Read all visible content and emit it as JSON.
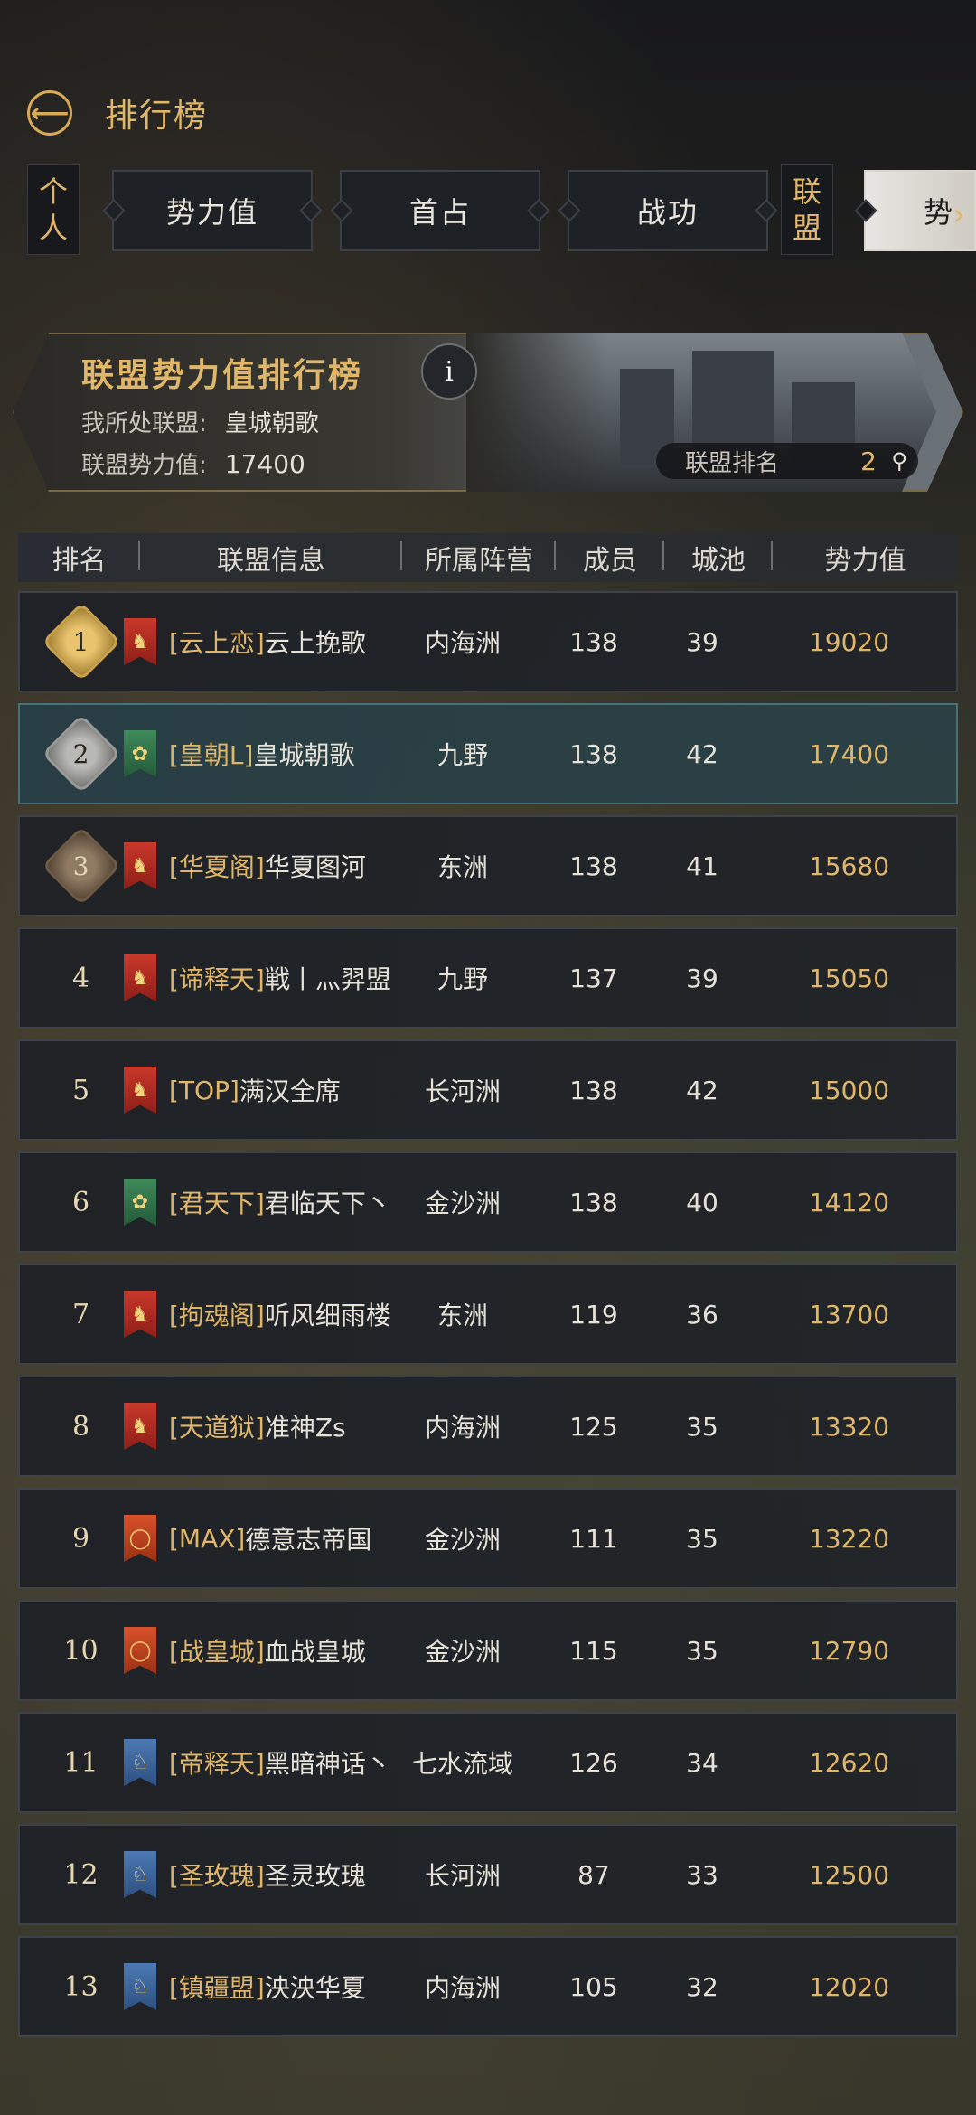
{
  "header": {
    "title": "排行榜"
  },
  "tabs": {
    "personal_label": [
      "个",
      "人"
    ],
    "items": [
      "势力值",
      "首占",
      "战功"
    ],
    "alliance_label": [
      "联",
      "盟"
    ],
    "active": "势"
  },
  "banner": {
    "title": "联盟势力值排行榜",
    "my_alliance_label": "我所处联盟:",
    "my_alliance_value": "皇城朝歌",
    "power_label": "联盟势力值:",
    "power_value": "17400",
    "rank_label": "联盟排名",
    "rank_value": "2"
  },
  "table": {
    "headers": [
      "排名",
      "联盟信息",
      "所属阵营",
      "成员",
      "城池",
      "势力值"
    ],
    "rows": [
      {
        "rank": "1",
        "tag": "[云上恋]",
        "name": "云上挽歌",
        "camp": "内海洲",
        "members": "138",
        "cities": "39",
        "power": "19020",
        "flag": "red"
      },
      {
        "rank": "2",
        "tag": "[皇朝L]",
        "name": "皇城朝歌",
        "camp": "九野",
        "members": "138",
        "cities": "42",
        "power": "17400",
        "flag": "green"
      },
      {
        "rank": "3",
        "tag": "[华夏阁]",
        "name": "华夏图河",
        "camp": "东洲",
        "members": "138",
        "cities": "41",
        "power": "15680",
        "flag": "red"
      },
      {
        "rank": "4",
        "tag": "[谛释天]",
        "name": "戦丨灬羿盟",
        "camp": "九野",
        "members": "137",
        "cities": "39",
        "power": "15050",
        "flag": "red"
      },
      {
        "rank": "5",
        "tag": "[TOP]",
        "name": "满汉全席",
        "camp": "长河洲",
        "members": "138",
        "cities": "42",
        "power": "15000",
        "flag": "red"
      },
      {
        "rank": "6",
        "tag": "[君天下]",
        "name": "君临天下丶",
        "camp": "金沙洲",
        "members": "138",
        "cities": "40",
        "power": "14120",
        "flag": "green"
      },
      {
        "rank": "7",
        "tag": "[拘魂阁]",
        "name": "听风细雨楼",
        "camp": "东洲",
        "members": "119",
        "cities": "36",
        "power": "13700",
        "flag": "red"
      },
      {
        "rank": "8",
        "tag": "[天道狱]",
        "name": "准神Zs",
        "camp": "内海洲",
        "members": "125",
        "cities": "35",
        "power": "13320",
        "flag": "red"
      },
      {
        "rank": "9",
        "tag": "[MAX]",
        "name": "德意志帝国",
        "camp": "金沙洲",
        "members": "111",
        "cities": "35",
        "power": "13220",
        "flag": "orange"
      },
      {
        "rank": "10",
        "tag": "[战皇城]",
        "name": "血战皇城",
        "camp": "金沙洲",
        "members": "115",
        "cities": "35",
        "power": "12790",
        "flag": "orange"
      },
      {
        "rank": "11",
        "tag": "[帝释天]",
        "name": "黑暗神话丶",
        "camp": "七水流域",
        "members": "126",
        "cities": "34",
        "power": "12620",
        "flag": "blue"
      },
      {
        "rank": "12",
        "tag": "[圣玫瑰]",
        "name": "圣灵玫瑰",
        "camp": "长河洲",
        "members": "87",
        "cities": "33",
        "power": "12500",
        "flag": "blue"
      },
      {
        "rank": "13",
        "tag": "[镇疆盟]",
        "name": "泱泱华夏",
        "camp": "内海洲",
        "members": "105",
        "cities": "32",
        "power": "12020",
        "flag": "blue"
      }
    ]
  },
  "colors": {
    "gold": "#e0b76a",
    "highlight_row": "#2a4248"
  }
}
